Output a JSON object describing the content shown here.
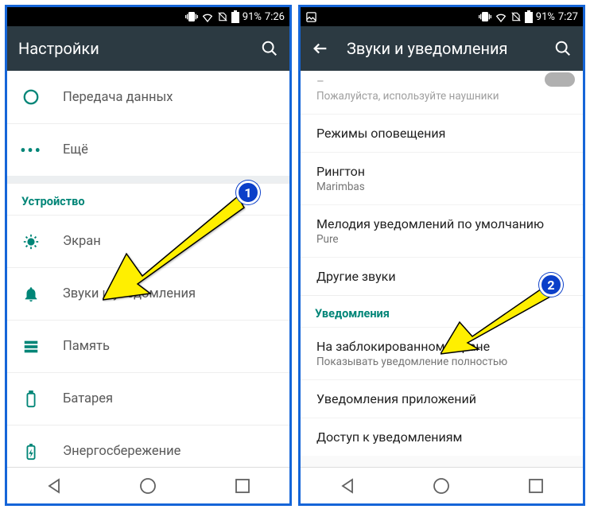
{
  "left": {
    "status": {
      "battery": "91%",
      "time": "7:26"
    },
    "title": "Настройки",
    "items": {
      "data_usage": "Передача данных",
      "more": "Ещё",
      "section_device": "Устройство",
      "display": "Экран",
      "sound": "Звуки и уведомления",
      "storage": "Память",
      "battery": "Батарея",
      "energy": "Энергосбережение"
    },
    "badge": "1"
  },
  "right": {
    "status": {
      "battery": "91%",
      "time": "7:27"
    },
    "title": "Звуки и уведомления",
    "partial_hint": "Пожалуйста, используйте наушники",
    "items": {
      "alert_modes": "Режимы оповещения",
      "ringtone": {
        "title": "Рингтон",
        "sub": "Marimbas"
      },
      "notif_melody": {
        "title": "Мелодия уведомлений по умолчанию",
        "sub": "Pure"
      },
      "other_sounds": "Другие звуки",
      "section_notif": "Уведомления",
      "lock_screen": {
        "title": "На заблокированном экране",
        "sub": "Показывать уведомление полностью"
      },
      "app_notif": "Уведомления приложений",
      "notif_access": "Доступ к уведомлениям"
    },
    "badge": "2"
  }
}
